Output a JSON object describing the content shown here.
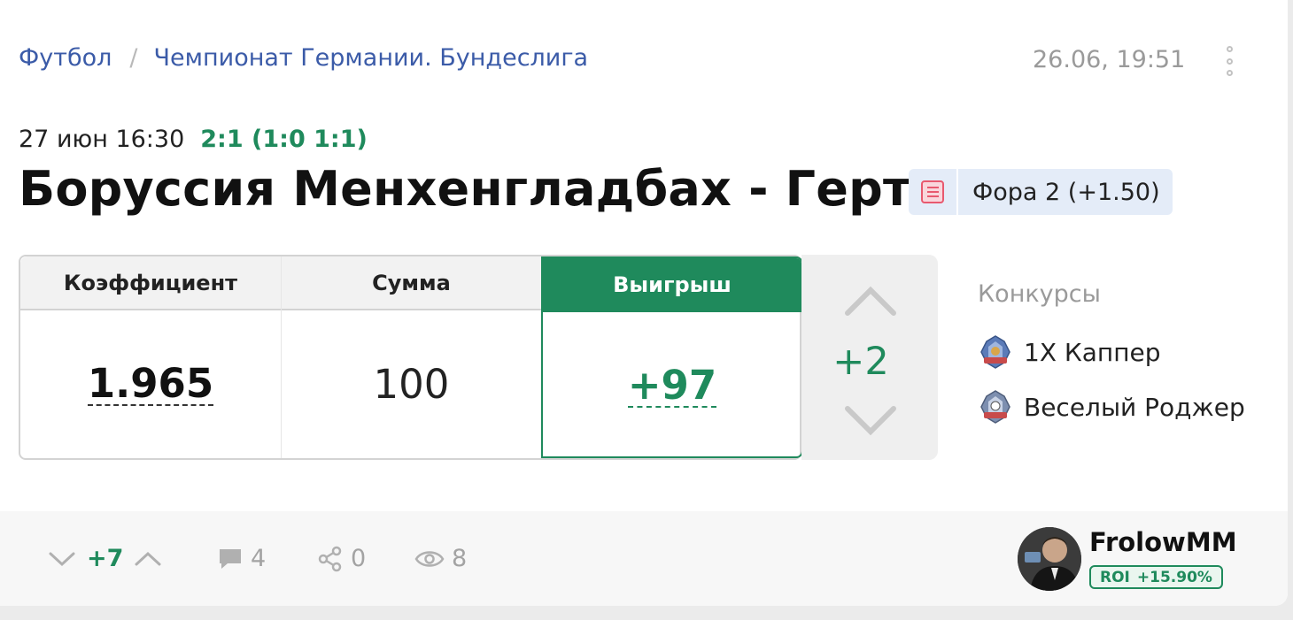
{
  "breadcrumb": {
    "sport": "Футбол",
    "separator": "/",
    "league": "Чемпионат Германии. Бундеслига"
  },
  "post": {
    "datetime": "26.06, 19:51"
  },
  "match": {
    "kickoff": "27 июн 16:30",
    "score": "2:1 (1:0 1:1)",
    "teams": "Боруссия Менхенгладбах - Герта"
  },
  "bet": {
    "type_label": "Фора 2 (+1.50)",
    "icon": "list-icon"
  },
  "calculator": {
    "odds_header": "Коэффициент",
    "sum_header": "Сумма",
    "win_header": "Выигрыш",
    "odds_value": "1.965",
    "sum_value": "100",
    "win_value": "+97"
  },
  "stepper": {
    "value": "+2"
  },
  "contests": {
    "title": "Конкурсы",
    "items": [
      {
        "label": "1X Каппер",
        "icon": "contest-badge-icon"
      },
      {
        "label": "Веселый Роджер",
        "icon": "contest-badge-icon"
      }
    ]
  },
  "footer": {
    "votes": "+7",
    "comments": "4",
    "shares": "0",
    "views": "8"
  },
  "author": {
    "name": "FrolowMM",
    "roi_label": "ROI",
    "roi_value": "+15.90%"
  },
  "colors": {
    "accent_green": "#1f8a5c",
    "link_blue": "#3b5ba8",
    "tag_bg": "#e4ecf8"
  }
}
